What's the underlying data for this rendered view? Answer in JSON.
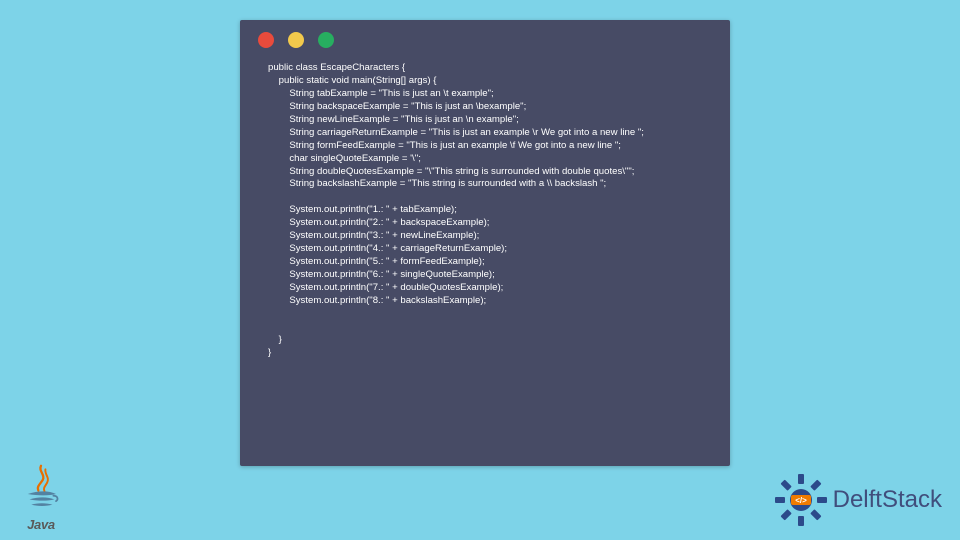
{
  "code_window": {
    "colors": {
      "bg": "#474b65",
      "fg": "#ffffff",
      "red": "#e94b3c",
      "yellow": "#f2c94c",
      "green": "#27ae60"
    },
    "lines": [
      "public class EscapeCharacters {",
      "    public static void main(String[] args) {",
      "        String tabExample = \"This is just an \\t example\";",
      "        String backspaceExample = \"This is just an \\bexample\";",
      "        String newLineExample = \"This is just an \\n example\";",
      "        String carriageReturnExample = \"This is just an example \\r We got into a new line \";",
      "        String formFeedExample = \"This is just an example \\f We got into a new line \";",
      "        char singleQuoteExample = '\\'';",
      "        String doubleQuotesExample = \"\\\"This string is surrounded with double quotes\\\"\";",
      "        String backslashExample = \"This string is surrounded with a \\\\ backslash \";",
      "",
      "        System.out.println(\"1.: \" + tabExample);",
      "        System.out.println(\"2.: \" + backspaceExample);",
      "        System.out.println(\"3.: \" + newLineExample);",
      "        System.out.println(\"4.: \" + carriageReturnExample);",
      "        System.out.println(\"5.: \" + formFeedExample);",
      "        System.out.println(\"6.: \" + singleQuoteExample);",
      "        System.out.println(\"7.: \" + doubleQuotesExample);",
      "        System.out.println(\"8.: \" + backslashExample);",
      "",
      "",
      "    }",
      "}"
    ]
  },
  "java_logo": {
    "text": "Java"
  },
  "delftstack": {
    "text": "DelftStack"
  }
}
